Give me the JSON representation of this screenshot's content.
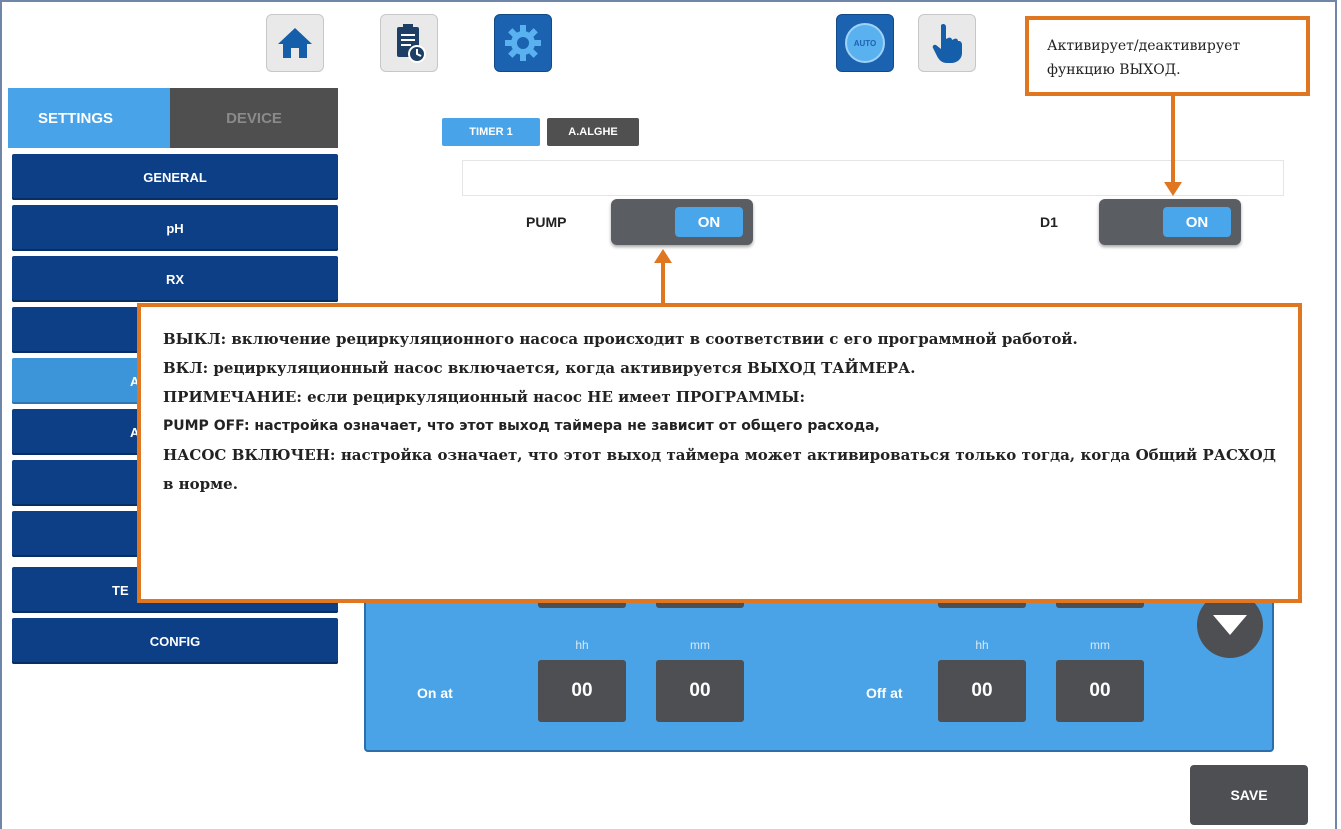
{
  "toolbar": {
    "home_icon": "home-icon",
    "log_icon": "clipboard-clock-icon",
    "settings_icon": "gear-icon",
    "auto_label": "AUTO",
    "manual_icon": "hand-pointer-icon"
  },
  "sidebar": {
    "tabs": [
      {
        "label": "SETTINGS",
        "active": true
      },
      {
        "label": "DEVICE",
        "active": false
      }
    ],
    "items": [
      {
        "label": "GENERAL"
      },
      {
        "label": "pH"
      },
      {
        "label": "RX"
      },
      {
        "label": ""
      },
      {
        "label": "A"
      },
      {
        "label": "A"
      },
      {
        "label": ""
      },
      {
        "label": ""
      },
      {
        "label": "TE"
      },
      {
        "label": "CONFIG"
      }
    ]
  },
  "main": {
    "tabs": [
      {
        "label": "TIMER 1",
        "active": true
      },
      {
        "label": "A.ALGHE",
        "active": false
      }
    ],
    "name_value": "",
    "pump": {
      "label": "PUMP",
      "state": "ON"
    },
    "d1": {
      "label": "D1",
      "state": "ON"
    },
    "time": {
      "hh_label": "hh",
      "mm_label": "mm",
      "on_label": "On at",
      "off_label": "Off at",
      "on_hh": "00",
      "on_mm": "00",
      "off_hh": "00",
      "off_mm": "00"
    },
    "save_label": "SAVE"
  },
  "callouts": {
    "top": "Активирует/деактивирует функцию ВЫХОД.",
    "main": [
      "ВЫКЛ: включение рециркуляционного насоса происходит в соответствии с его программной работой.",
      "ВКЛ: рециркуляционный насос включается, когда активируется ВЫХОД ТАЙМЕРА.",
      "ПРИМЕЧАНИЕ: если рециркуляционный насос НЕ имеет ПРОГРАММЫ:",
      "PUMP OFF: настройка означает, что этот выход таймера не зависит от общего расхода,",
      "НАСОС ВКЛЮЧЕН: настройка означает, что этот выход таймера может активироваться только тогда, когда Общий РАСХОД в норме."
    ]
  },
  "colors": {
    "accent_blue": "#49a3e8",
    "dark_blue": "#0c3f86",
    "dark_gray": "#4d4f53",
    "callout_orange": "#e0761f"
  }
}
